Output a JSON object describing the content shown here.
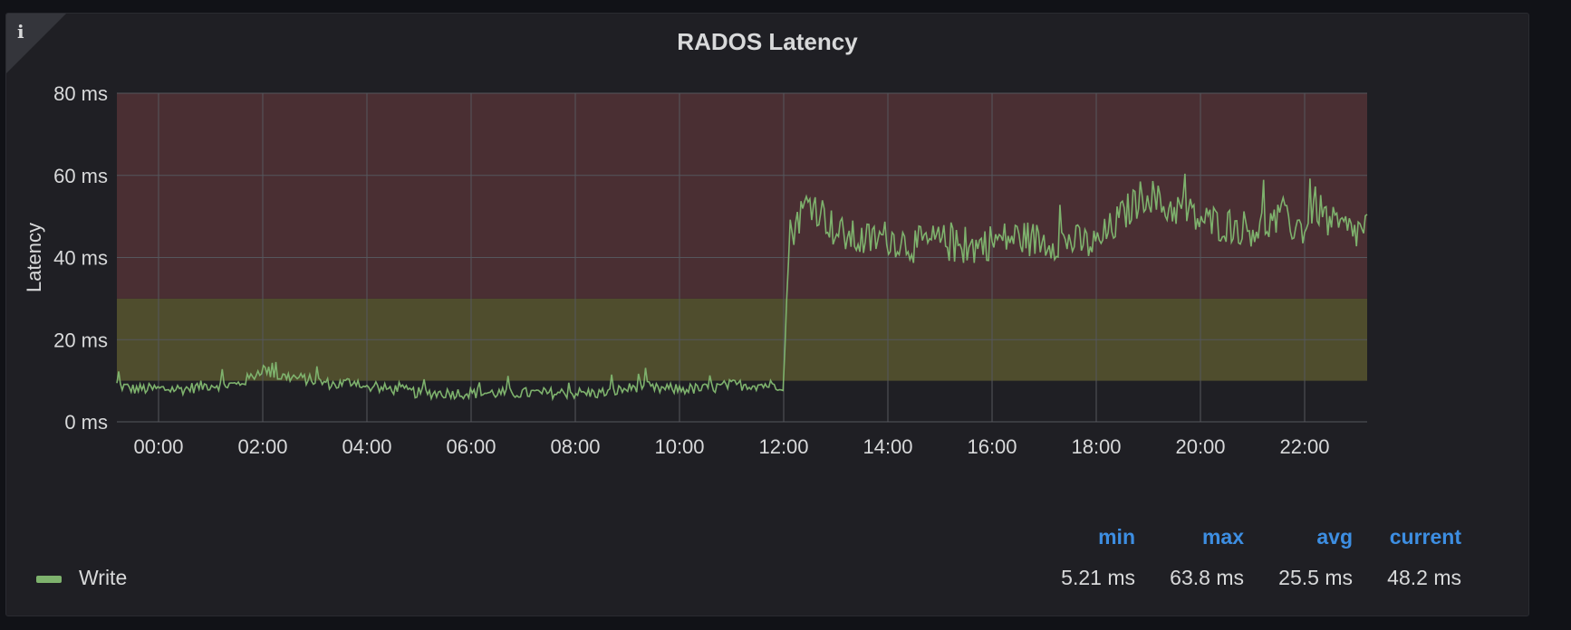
{
  "panel": {
    "title": "RADOS Latency",
    "info_icon": "info-icon"
  },
  "colors": {
    "background": "#1f1f24",
    "series_line": "#7eb26d",
    "threshold_critical": "#4a2f33",
    "threshold_warning": "#4f4d2d",
    "stat_header": "#3d8ee2",
    "grid": "#55575d"
  },
  "chart_data": {
    "type": "line",
    "title": "RADOS Latency",
    "xlabel": "",
    "ylabel": "Latency",
    "y_unit": "ms",
    "ylim": [
      0,
      80
    ],
    "xlim": [
      -0.8,
      23.2
    ],
    "x_ticks": [
      "00:00",
      "02:00",
      "04:00",
      "06:00",
      "08:00",
      "10:00",
      "12:00",
      "14:00",
      "16:00",
      "18:00",
      "20:00",
      "22:00"
    ],
    "y_ticks": [
      "0 ms",
      "20 ms",
      "40 ms",
      "60 ms",
      "80 ms"
    ],
    "grid": true,
    "legend_position": "bottom-left",
    "thresholds": [
      {
        "from": 10,
        "to": 30,
        "level": "warning"
      },
      {
        "from": 30,
        "to": 80,
        "level": "critical"
      }
    ],
    "series": [
      {
        "name": "Write",
        "x_hours": [
          -0.8,
          -0.5,
          0,
          0.5,
          1,
          1.5,
          1.8,
          2,
          2.3,
          2.5,
          3,
          3.4,
          3.8,
          4,
          4.5,
          5,
          5.5,
          6,
          6.5,
          7,
          7.5,
          8,
          8.5,
          9,
          9.3,
          9.5,
          10,
          10.5,
          11,
          11.5,
          11.8,
          12,
          12.1,
          12.3,
          12.5,
          12.8,
          13,
          13.5,
          14,
          14.5,
          15,
          15.5,
          16,
          16.5,
          17,
          17.5,
          18,
          18.5,
          18.8,
          19,
          19.3,
          19.6,
          20,
          20.5,
          21,
          21.5,
          22,
          22.2,
          22.5,
          23,
          23.2
        ],
        "values_ms": [
          9,
          8,
          8,
          8,
          9,
          9,
          11,
          13,
          11,
          11,
          10,
          9,
          10,
          8,
          8,
          7,
          7,
          7,
          7,
          7,
          7,
          7,
          7,
          8,
          9,
          8,
          8,
          8,
          9,
          9,
          9,
          9,
          45,
          50,
          54,
          50,
          46,
          44,
          45,
          43,
          44,
          42,
          44,
          45,
          44,
          44,
          43,
          50,
          54,
          56,
          52,
          52,
          49,
          48,
          47,
          49,
          47,
          53,
          48,
          46,
          48
        ]
      }
    ]
  },
  "legend": {
    "items": [
      {
        "name": "Write"
      }
    ],
    "stat_headers": [
      "min",
      "max",
      "avg",
      "current"
    ],
    "stat_values": [
      "5.21 ms",
      "63.8 ms",
      "25.5 ms",
      "48.2 ms"
    ]
  }
}
